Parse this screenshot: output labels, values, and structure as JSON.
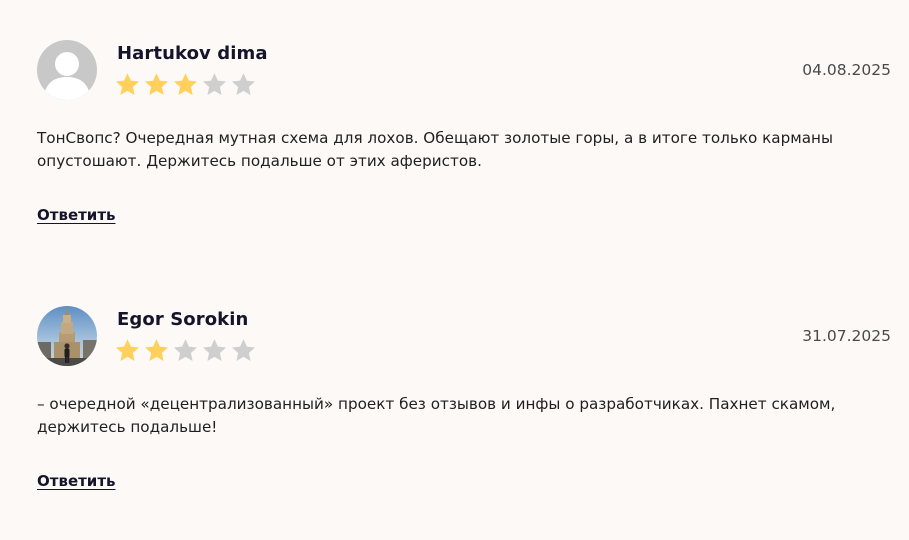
{
  "reviews": [
    {
      "author": "Hartukov dima",
      "date": "04.08.2025",
      "rating": 3,
      "max_rating": 5,
      "avatar": "default-user-icon",
      "text": "ТонСвопс? Очередная мутная схема для лохов. Обещают золотые горы, а в итоге только карманы опустошают. Держитесь подальше от этих аферистов.",
      "reply_label": "Ответить"
    },
    {
      "author": "Egor Sorokin",
      "date": "31.07.2025",
      "rating": 2,
      "max_rating": 5,
      "avatar": "user-photo",
      "text": "– очередной «децентрализованный» проект без отзывов и инфы о разработчиках. Пахнет скамом, держитесь подальше!",
      "reply_label": "Ответить"
    }
  ],
  "colors": {
    "background": "#fdf9f6",
    "star_filled": "#ffd15c",
    "star_empty": "#cfcfcf",
    "author": "#14142a"
  }
}
